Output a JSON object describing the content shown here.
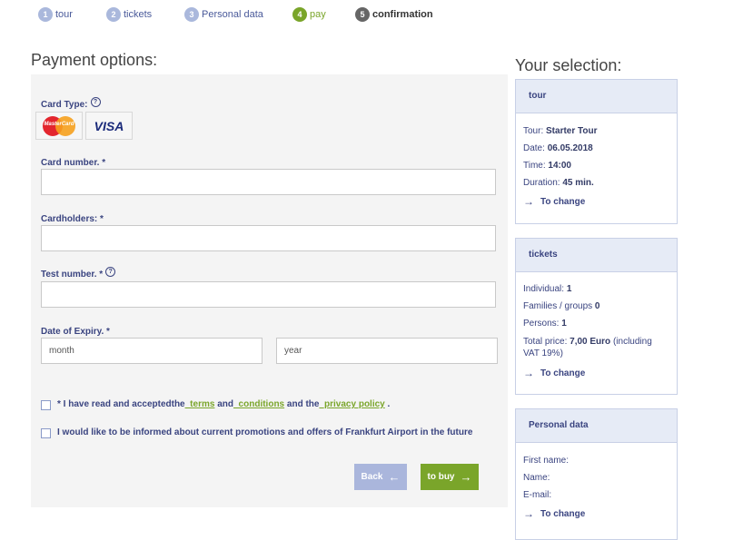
{
  "steps": [
    {
      "num": "1",
      "label": "tour"
    },
    {
      "num": "2",
      "label": "tickets"
    },
    {
      "num": "3",
      "label": "Personal data"
    },
    {
      "num": "4",
      "label": "pay"
    },
    {
      "num": "5",
      "label": "confirmation"
    }
  ],
  "payment": {
    "title": "Payment options:",
    "card_type_label": "Card Type:",
    "card_mastercard": "MasterCard",
    "card_visa": "VISA",
    "card_number_label": "Card number. *",
    "cardholders_label": "Cardholders: *",
    "test_number_label": "Test number. *",
    "expiry_label": "Date of Expiry. *",
    "month_value": "month",
    "year_value": "year",
    "terms_prefix": "* I have  read and acceptedthe",
    "terms_link": "_terms",
    "and_text": "and",
    "conditions_link": "_conditions",
    "and_the_text": "and the",
    "privacy_link": "_privacy policy",
    "terms_suffix": ".",
    "promo_text": "I would like to be informed about current promotions and offers of Frankfurt Airport in the future",
    "back_label": "Back",
    "buy_label": "to buy"
  },
  "selection": {
    "title": "Your selection:",
    "change_label": "To change",
    "tour": {
      "header": "tour",
      "tour_label": "Tour:",
      "tour_value": "Starter Tour",
      "date_label": "Date:",
      "date_value": "06.05.2018",
      "time_label": "Time:",
      "time_value": "14:00",
      "duration_label": "Duration:",
      "duration_value": "45 min."
    },
    "tickets": {
      "header": "tickets",
      "individual_label": "Individual:",
      "individual_value": "1",
      "families_label": "Families / groups",
      "families_value": "0",
      "persons_label": "Persons:",
      "persons_value": "1",
      "price_label": "Total price:",
      "price_value": "7,00 Euro",
      "price_suffix": "(including",
      "price_suffix2": "VAT 19%)"
    },
    "personal": {
      "header": "Personal data",
      "first_name_label": "First name:",
      "name_label": "Name:",
      "email_label": "E-mail:"
    }
  },
  "colors": {
    "accent_green": "#7aa52a",
    "step_inactive": "#aab8dc",
    "text_navy": "#3a4480",
    "panel_bg": "#f4f4f4"
  },
  "icons": [
    "info-icon",
    "mastercard-logo",
    "visa-logo",
    "arrow-left-icon",
    "arrow-right-icon"
  ]
}
